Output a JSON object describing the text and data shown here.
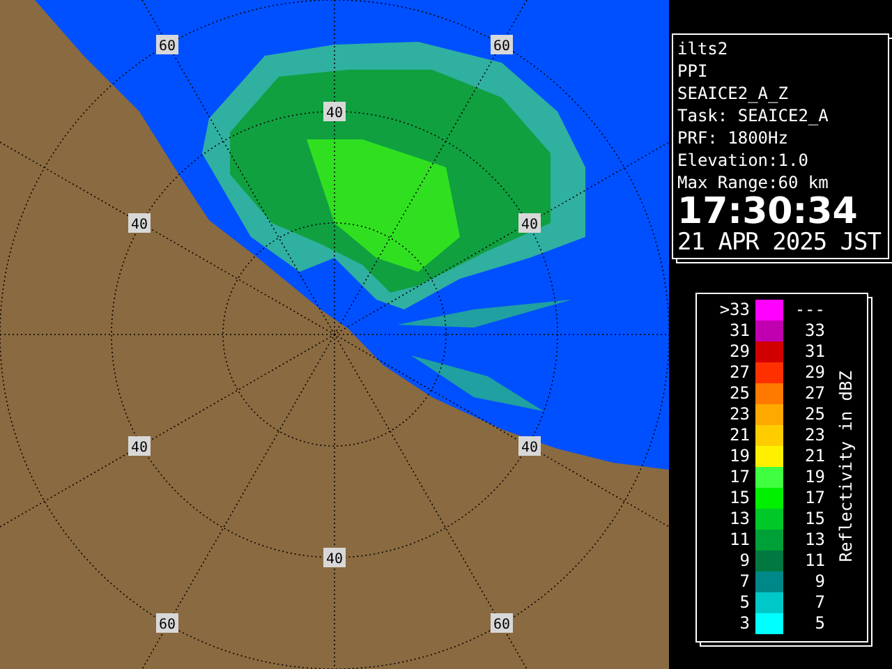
{
  "map": {
    "range_labels": [
      "60",
      "60",
      "40",
      "40",
      "40",
      "40",
      "40",
      "40",
      "60",
      "60"
    ]
  },
  "info": {
    "lines": [
      "ilts2",
      "PPI",
      "SEAICE2_A_Z",
      "Task: SEAICE2_A",
      "PRF: 1800Hz",
      "Elevation:1.0",
      "Max Range:60 km"
    ],
    "time": "17:30:34",
    "date": "21 APR 2025 JST"
  },
  "legend": {
    "title": "Reflectivity in dBZ",
    "rows": [
      {
        "low": ">33",
        "high": "---",
        "color": "#ff00ff"
      },
      {
        "low": "31",
        "high": "33",
        "color": "#c000b0"
      },
      {
        "low": "29",
        "high": "31",
        "color": "#d00000"
      },
      {
        "low": "27",
        "high": "29",
        "color": "#ff3000"
      },
      {
        "low": "25",
        "high": "27",
        "color": "#ff7800"
      },
      {
        "low": "23",
        "high": "25",
        "color": "#ffa800"
      },
      {
        "low": "21",
        "high": "23",
        "color": "#ffcc00"
      },
      {
        "low": "19",
        "high": "21",
        "color": "#fff000"
      },
      {
        "low": "17",
        "high": "19",
        "color": "#40ff40"
      },
      {
        "low": "15",
        "high": "17",
        "color": "#00f000"
      },
      {
        "low": "13",
        "high": "15",
        "color": "#00c828"
      },
      {
        "low": "11",
        "high": "13",
        "color": "#00a038"
      },
      {
        "low": "9",
        "high": "11",
        "color": "#007840"
      },
      {
        "low": "7",
        "high": "9",
        "color": "#008888"
      },
      {
        "low": "5",
        "high": "7",
        "color": "#00c8c8"
      },
      {
        "low": "3",
        "high": "5",
        "color": "#00ffff"
      }
    ]
  }
}
